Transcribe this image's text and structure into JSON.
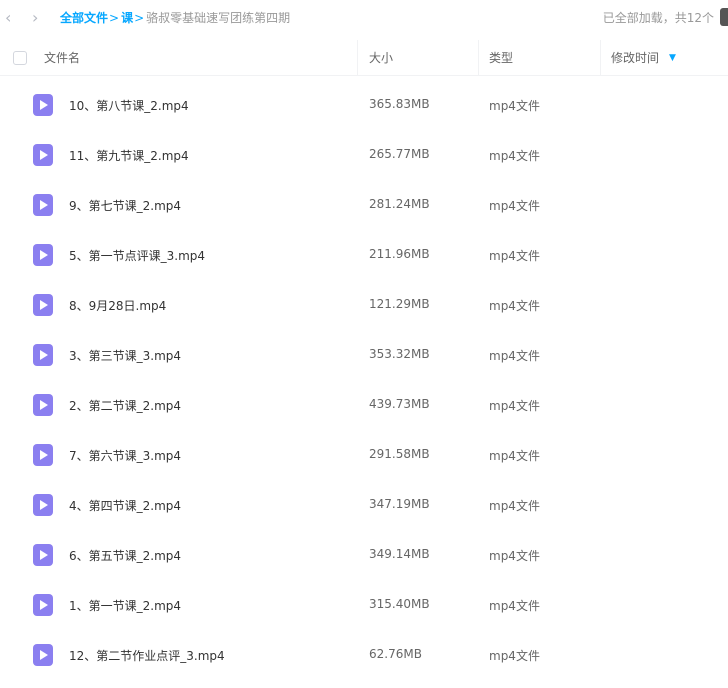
{
  "nav": {
    "back": "‹",
    "forward": "›"
  },
  "breadcrumb": {
    "root": "全部文件",
    "sep1": ">",
    "parent": "课",
    "sep2": ">",
    "current": "骆叔零基础速写团练第四期"
  },
  "status": "已全部加载，共12个",
  "columns": {
    "name": "文件名",
    "size": "大小",
    "type": "类型",
    "modified": "修改时间"
  },
  "sort": {
    "icon": "sort-desc-icon",
    "glyph": "▼"
  },
  "colors": {
    "accent": "#06a7ff",
    "video_icon": "#8b7ff0"
  },
  "files": [
    {
      "name": "10、第八节课_2.mp4",
      "size": "365.83MB",
      "type": "mp4文件"
    },
    {
      "name": "11、第九节课_2.mp4",
      "size": "265.77MB",
      "type": "mp4文件"
    },
    {
      "name": "9、第七节课_2.mp4",
      "size": "281.24MB",
      "type": "mp4文件"
    },
    {
      "name": "5、第一节点评课_3.mp4",
      "size": "211.96MB",
      "type": "mp4文件"
    },
    {
      "name": "8、9月28日.mp4",
      "size": "121.29MB",
      "type": "mp4文件"
    },
    {
      "name": "3、第三节课_3.mp4",
      "size": "353.32MB",
      "type": "mp4文件"
    },
    {
      "name": "2、第二节课_2.mp4",
      "size": "439.73MB",
      "type": "mp4文件"
    },
    {
      "name": "7、第六节课_3.mp4",
      "size": "291.58MB",
      "type": "mp4文件"
    },
    {
      "name": "4、第四节课_2.mp4",
      "size": "347.19MB",
      "type": "mp4文件"
    },
    {
      "name": "6、第五节课_2.mp4",
      "size": "349.14MB",
      "type": "mp4文件"
    },
    {
      "name": "1、第一节课_2.mp4",
      "size": "315.40MB",
      "type": "mp4文件"
    },
    {
      "name": "12、第二节作业点评_3.mp4",
      "size": "62.76MB",
      "type": "mp4文件"
    }
  ]
}
